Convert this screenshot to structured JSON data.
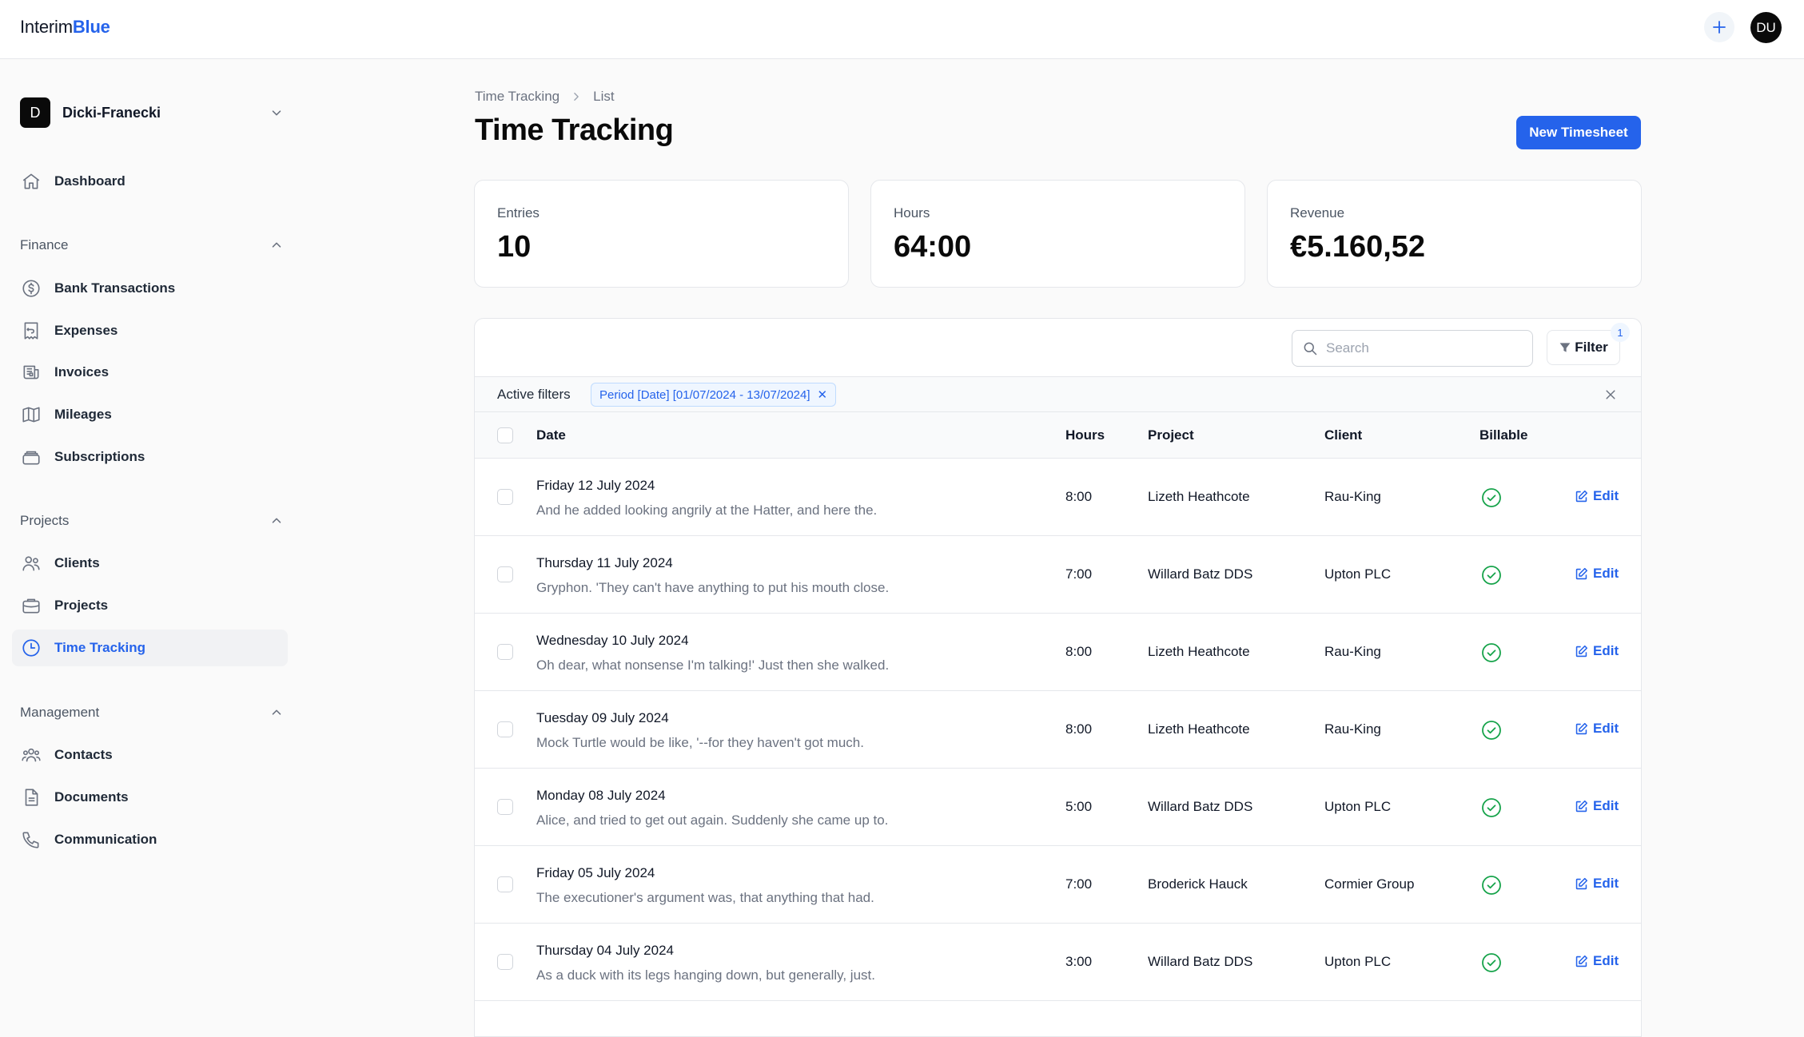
{
  "topbar": {
    "brand_prefix": "Interim",
    "brand_accent": "Blue",
    "user_initials": "DU"
  },
  "sidebar": {
    "org": {
      "initial": "D",
      "name": "Dicki-Franecki"
    },
    "dashboard": {
      "label": "Dashboard",
      "icon": "home-icon"
    },
    "sections": [
      {
        "title": "Finance",
        "items": [
          {
            "label": "Bank Transactions",
            "icon": "dollar-circle-icon"
          },
          {
            "label": "Expenses",
            "icon": "receipt-icon"
          },
          {
            "label": "Invoices",
            "icon": "newspaper-icon"
          },
          {
            "label": "Mileages",
            "icon": "map-icon"
          },
          {
            "label": "Subscriptions",
            "icon": "stack-icon"
          }
        ]
      },
      {
        "title": "Projects",
        "items": [
          {
            "label": "Clients",
            "icon": "users-icon"
          },
          {
            "label": "Projects",
            "icon": "briefcase-icon"
          },
          {
            "label": "Time Tracking",
            "icon": "clock-icon",
            "active": true
          }
        ]
      },
      {
        "title": "Management",
        "items": [
          {
            "label": "Contacts",
            "icon": "user-group-icon"
          },
          {
            "label": "Documents",
            "icon": "document-icon"
          },
          {
            "label": "Communication",
            "icon": "phone-icon"
          }
        ]
      }
    ]
  },
  "main": {
    "breadcrumb": [
      "Time Tracking",
      "List"
    ],
    "title": "Time Tracking",
    "new_button": "New Timesheet",
    "stats": [
      {
        "label": "Entries",
        "value": "10"
      },
      {
        "label": "Hours",
        "value": "64:00"
      },
      {
        "label": "Revenue",
        "value": "€5.160,52"
      }
    ]
  },
  "table": {
    "search_placeholder": "Search",
    "filter_label": "Filter",
    "filter_count": "1",
    "active_filters_label": "Active filters",
    "filter_chip": "Period [Date] [01/07/2024 - 13/07/2024]",
    "columns": {
      "date": "Date",
      "hours": "Hours",
      "project": "Project",
      "client": "Client",
      "billable": "Billable"
    },
    "edit_label": "Edit",
    "rows": [
      {
        "date": "Friday 12 July 2024",
        "description": "And he added looking angrily at the Hatter, and here the.",
        "hours": "8:00",
        "project": "Lizeth Heathcote",
        "client": "Rau-King",
        "billable": true
      },
      {
        "date": "Thursday 11 July 2024",
        "description": "Gryphon. 'They can't have anything to put his mouth close.",
        "hours": "7:00",
        "project": "Willard Batz DDS",
        "client": "Upton PLC",
        "billable": true
      },
      {
        "date": "Wednesday 10 July 2024",
        "description": "Oh dear, what nonsense I'm talking!' Just then she walked.",
        "hours": "8:00",
        "project": "Lizeth Heathcote",
        "client": "Rau-King",
        "billable": true
      },
      {
        "date": "Tuesday 09 July 2024",
        "description": "Mock Turtle would be like, '--for they haven't got much.",
        "hours": "8:00",
        "project": "Lizeth Heathcote",
        "client": "Rau-King",
        "billable": true
      },
      {
        "date": "Monday 08 July 2024",
        "description": "Alice, and tried to get out again. Suddenly she came up to.",
        "hours": "5:00",
        "project": "Willard Batz DDS",
        "client": "Upton PLC",
        "billable": true
      },
      {
        "date": "Friday 05 July 2024",
        "description": "The executioner's argument was, that anything that had.",
        "hours": "7:00",
        "project": "Broderick Hauck",
        "client": "Cormier Group",
        "billable": true
      },
      {
        "date": "Thursday 04 July 2024",
        "description": "As a duck with its legs hanging down, but generally, just.",
        "hours": "3:00",
        "project": "Willard Batz DDS",
        "client": "Upton PLC",
        "billable": true
      }
    ]
  },
  "colors": {
    "accent": "#2563eb",
    "success": "#16a34a",
    "border": "#e5e7eb"
  }
}
